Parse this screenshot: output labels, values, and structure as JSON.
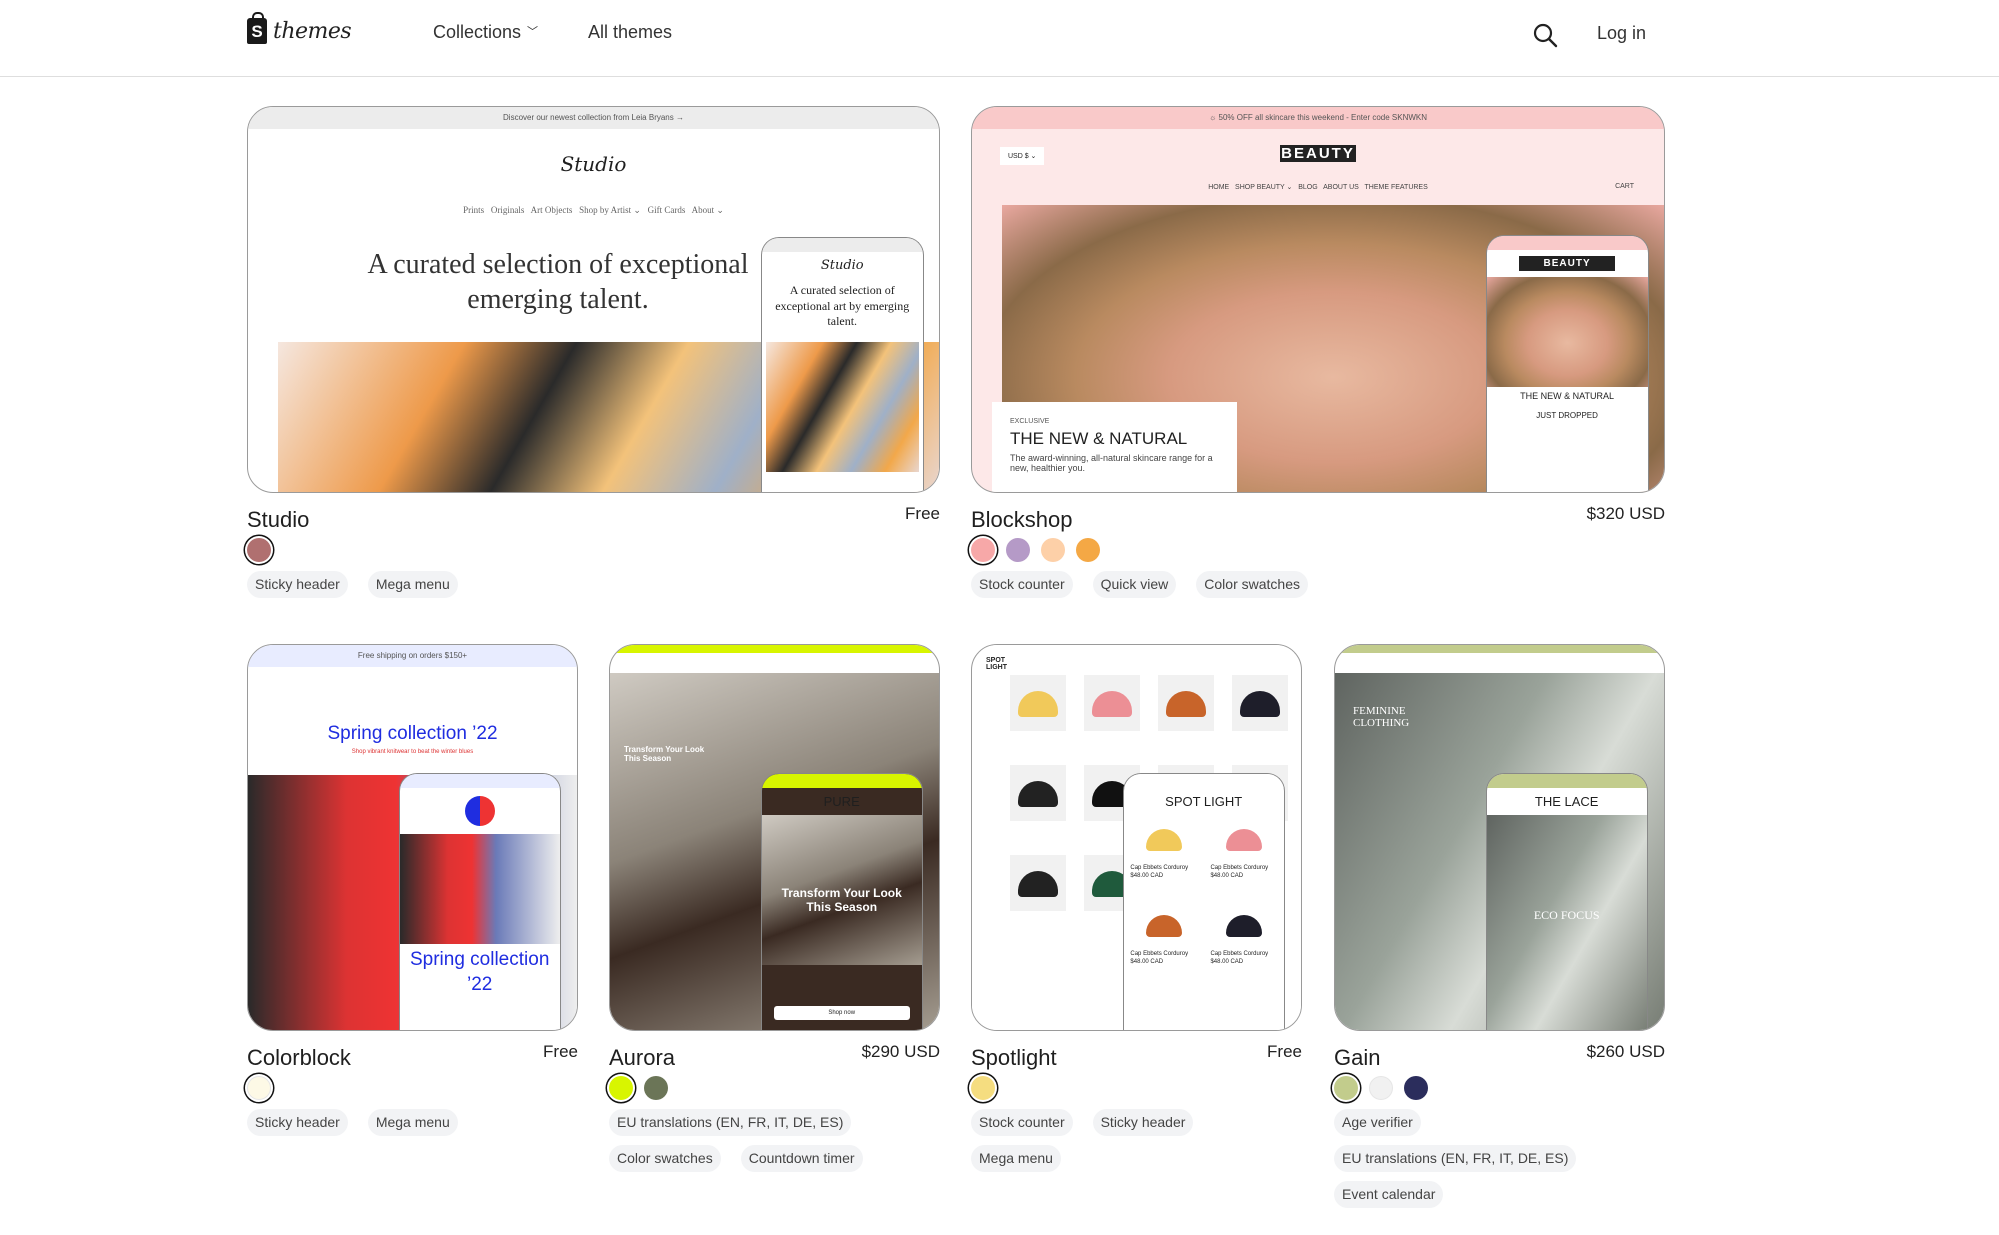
{
  "header": {
    "logo_text": "themes",
    "logo_icon": "shopify-bag-icon",
    "nav": [
      {
        "label": "Collections",
        "has_dropdown": true
      },
      {
        "label": "All themes",
        "has_dropdown": false
      }
    ],
    "search_icon": "search-icon",
    "login_label": "Log in"
  },
  "themes": [
    {
      "name": "Studio",
      "price": "Free",
      "swatches": [
        "#b07070"
      ],
      "tags": [
        "Sticky header",
        "Mega menu"
      ],
      "preview": {
        "announcement": "Discover our newest collection from Leia Bryans  →",
        "logo": "Studio",
        "nav": "Prints   Originals   Art Objects   Shop by Artist ⌄   Gift Cards   About ⌄",
        "headline": "A curated selection of exceptional emerging talent.",
        "mobile_headline": "A curated selection of exceptional art by emerging talent.",
        "bg": "#ffffff",
        "ann_bg": "#ececec",
        "photo": "linear-gradient(120deg,#f5e7df 0%,#ee9a4a 25%,#2a2a2a 40%,#f3c27a 55%,#9fb0c8 70%,#f2a84a 85%,#e9d6cf 100%)"
      }
    },
    {
      "name": "Blockshop",
      "price": "$320 USD",
      "swatches": [
        "#f7a8a8",
        "#b59ac7",
        "#fdd0a8",
        "#f4a845"
      ],
      "tags": [
        "Stock counter",
        "Quick view",
        "Color swatches"
      ],
      "preview": {
        "announcement": "☼ 50% OFF all skincare this weekend - Enter code SKNWKN",
        "logo": "BEAUTY",
        "currency": "USD $ ⌄",
        "nav": "HOME   SHOP BEAUTY ⌄   BLOG   ABOUT US   THEME FEATURES",
        "cart": "CART",
        "eyebrow": "EXCLUSIVE",
        "headline": "THE NEW & NATURAL",
        "body": "The award-winning, all-natural skincare range for a new, healthier you.",
        "mobile_headline": "THE NEW & NATURAL",
        "mobile_sub": "JUST DROPPED",
        "bg": "#fde8e8",
        "ann_bg": "#f9c9c9",
        "photo": "radial-gradient(ellipse at 50% 60%,#e8b9a0 0%,#d79a80 35%,#b98a60 55%,#8a6a48 75%,#e9a8a0 100%)"
      }
    },
    {
      "name": "Colorblock",
      "price": "Free",
      "swatches": [
        "#fdf9e6"
      ],
      "tags": [
        "Sticky header",
        "Mega menu"
      ],
      "preview": {
        "announcement": "Free shipping on orders $150+",
        "headline": "Spring collection ’22",
        "sub": "Shop vibrant knitwear to beat the winter blues",
        "mobile_headline": "Spring collection ’22",
        "bg": "#ffffff",
        "ann_bg": "#e8ecff",
        "accent": "#1f2de0",
        "photo": "linear-gradient(90deg,#2a2a2a 0%,#d33 30%,#e33 45%,#6a7ab8 60%,#eee 100%)"
      }
    },
    {
      "name": "Aurora",
      "price": "$290 USD",
      "swatches": [
        "#d8f500",
        "#6b7557"
      ],
      "tags": [
        "EU translations (EN, FR, IT, DE, ES)",
        "Color swatches",
        "Countdown timer"
      ],
      "preview": {
        "logo": "PURE",
        "headline": "Transform Your Look This Season",
        "button": "Shop now",
        "bg": "#ffffff",
        "ann_bg": "#d8f500",
        "photo": "linear-gradient(160deg,#cfcac2 0%,#8b8378 40%,#3a2a22 60%,#a49c90 100%)"
      }
    },
    {
      "name": "Spotlight",
      "price": "Free",
      "swatches": [
        "#f5dd80"
      ],
      "tags": [
        "Stock counter",
        "Sticky header",
        "Mega menu"
      ],
      "preview": {
        "logo": "SPOT LIGHT",
        "product": "Cap Ebbets Corduroy",
        "product_price": "$48.00 CAD",
        "bg": "#ffffff",
        "ann_bg": "#ffffff",
        "photo": "#f4f4f4"
      }
    },
    {
      "name": "Gain",
      "price": "$260 USD",
      "swatches": [
        "#c2cc8c",
        "#f1f1f1",
        "#2b2d5c"
      ],
      "tags": [
        "Age verifier",
        "EU translations (EN, FR, IT, DE, ES)",
        "Event calendar"
      ],
      "preview": {
        "logo": "THE LACE",
        "headline": "FEMININE CLOTHING",
        "mobile_headline": "ECO FOCUS",
        "bg": "#ffffff",
        "ann_bg": "#c2cc8c",
        "photo": "linear-gradient(120deg,#5f6460 0%,#9aa39a 40%,#d8dcd6 60%,#777d74 100%)"
      }
    }
  ]
}
